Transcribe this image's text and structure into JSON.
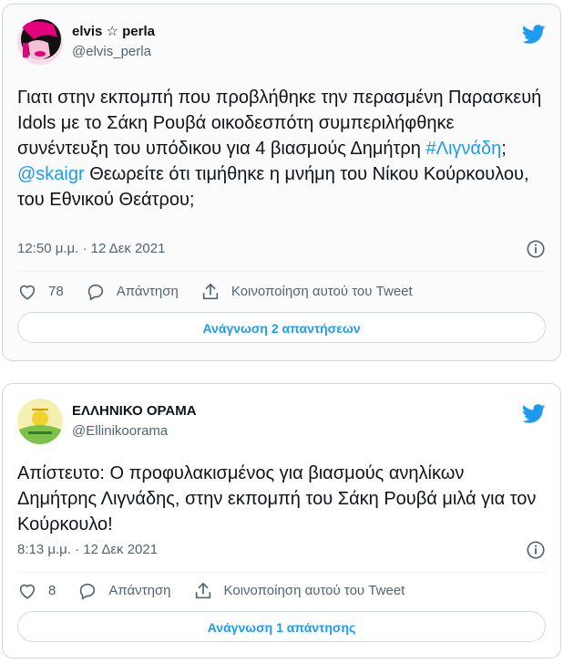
{
  "tweets": [
    {
      "display_name": "elvis ☆ perla",
      "handle": "@elvis_perla",
      "text_before": "Γιατι στην εκπομπή που προβλήθηκε την περασμένη Παρασκευή Idols με το Σάκη Ρουβά οικοδεσπότη συμπεριλήφθηκε συνέντευξη του υπόδικου για 4 βιασμούς  Δημήτρη ",
      "hashtag": "#Λιγνάδη",
      "text_mid": "; ",
      "mention": "@skaigr",
      "text_after": " Θεωρείτε ότι τιμήθηκε η μνήμη του Νίκου Κούρκουλου, του Εθνικού Θεάτρου;",
      "timestamp": "12:50 μ.μ. · 12 Δεκ 2021",
      "likes": "78",
      "reply_label": "Απάντηση",
      "share_label": "Κοινοποίηση αυτού του Tweet",
      "read_replies_label": "Ανάγνωση 2 απαντήσεων",
      "avatar_icon": "avatar-pink-portrait"
    },
    {
      "display_name": "ΕΛΛΗΝΙΚΟ ΟΡΑΜΑ",
      "handle": "@Ellinikoorama",
      "text": "Απίστευτο: Ο προφυλακισμένος για βιασμούς ανηλίκων Δημήτρης Λιγνάδης, στην εκπομπή του Σάκη Ρουβά μιλά για τον Κούρκουλο!",
      "timestamp": "8:13 μ.μ. · 12 Δεκ 2021",
      "likes": "8",
      "reply_label": "Απάντηση",
      "share_label": "Κοινοποίηση αυτού του Tweet",
      "read_replies_label": "Ανάγνωση 1 απάντησης",
      "avatar_icon": "avatar-party-logo"
    }
  ],
  "icons": {
    "bird": "twitter-bird-icon",
    "info": "info-icon",
    "like": "heart-icon",
    "reply": "reply-bubble-icon",
    "share": "share-upload-icon"
  },
  "colors": {
    "accent": "#1d9bf0",
    "text": "#0f1419",
    "muted": "#536471",
    "border": "#cfd9de"
  }
}
